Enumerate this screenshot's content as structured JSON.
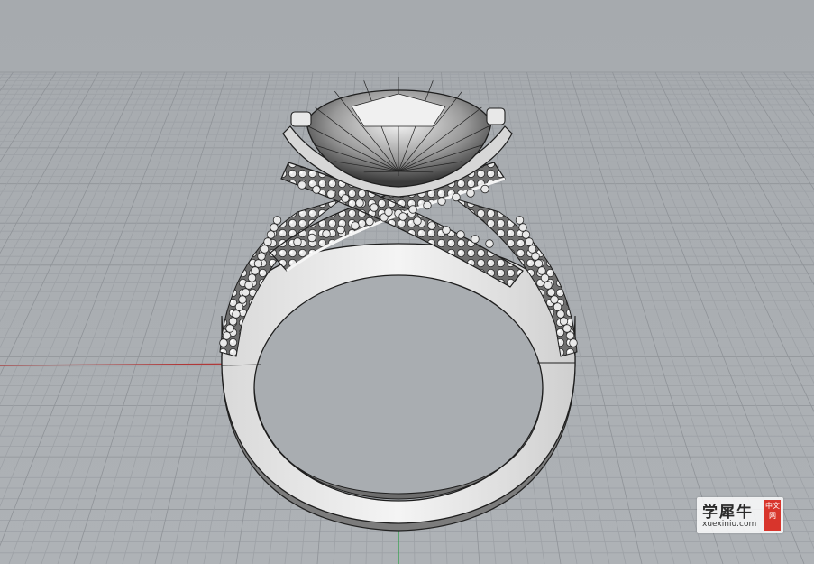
{
  "viewport": {
    "background_color": "#a9adb1",
    "grid_color": "#9da1a6",
    "grid_major_color": "#8f9398",
    "x_axis_color": "#b03838",
    "y_axis_color": "#2fa04a",
    "object": "ring-with-center-stone-and-pave-band"
  },
  "watermark": {
    "chinese_text": "学犀牛",
    "url_text": "xuexiniu.com",
    "badge_text": "中文网",
    "badge_color": "#d8352c"
  }
}
